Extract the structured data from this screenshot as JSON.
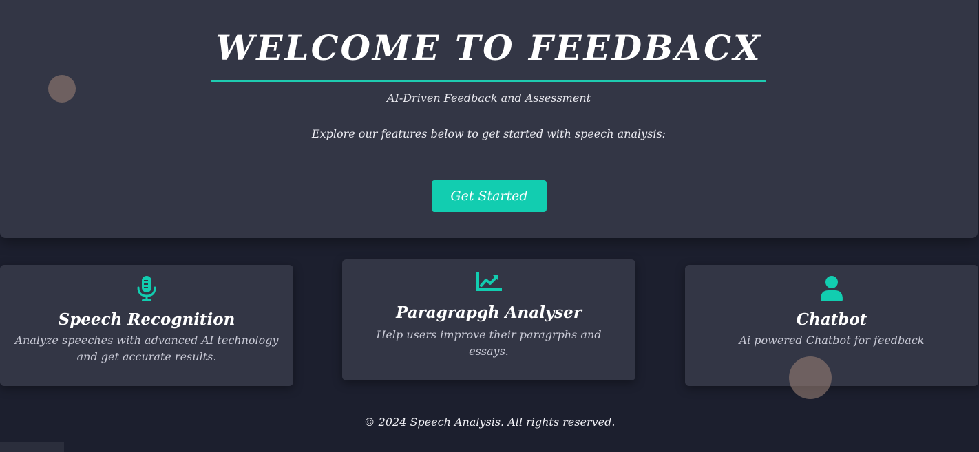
{
  "hero": {
    "title": "WELCOME TO FEEDBACX",
    "subtitle": "AI-Driven Feedback and Assessment",
    "explore": "Explore our features below to get started with speech analysis:",
    "cta_label": "Get Started"
  },
  "features": [
    {
      "icon": "microphone-icon",
      "title": "Speech Recognition",
      "description": "Analyze speeches with advanced AI technology and get accurate results."
    },
    {
      "icon": "chart-line-icon",
      "title": "Paragrapgh Analyser",
      "description": "Help users improve their paragrphs and essays."
    },
    {
      "icon": "user-icon",
      "title": "Chatbot",
      "description": "Ai powered Chatbot for feedback"
    }
  ],
  "footer": {
    "text": "© 2024 Speech Analysis. All rights reserved."
  },
  "colors": {
    "accent": "#12cdb0",
    "background": "#1c1f2e",
    "card": "#333645"
  }
}
